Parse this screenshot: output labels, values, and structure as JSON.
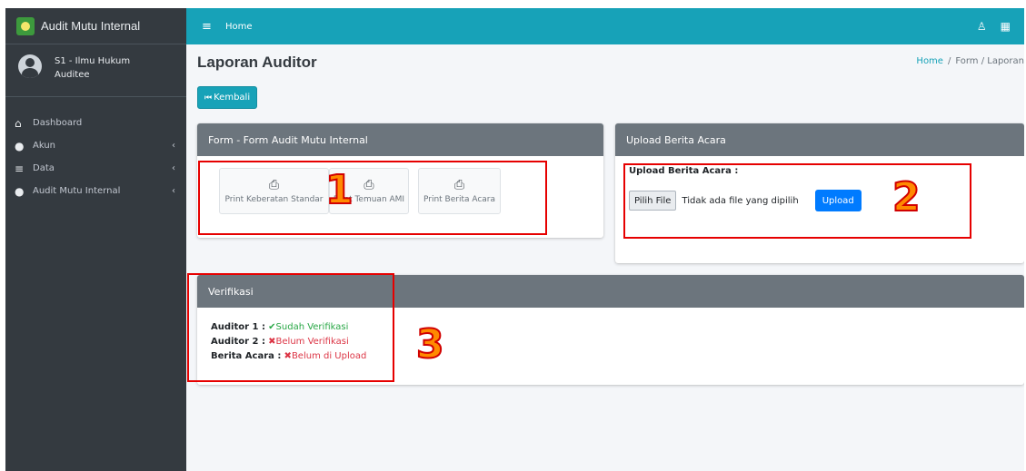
{
  "brand": {
    "title": "Audit Mutu Internal"
  },
  "user": {
    "name": "S1 - Ilmu Hukum",
    "role": "Auditee"
  },
  "sidebar": {
    "items": [
      {
        "label": "Dashboard",
        "icon": "home-icon",
        "caret": ""
      },
      {
        "label": "Akun",
        "icon": "user-icon",
        "caret": "‹"
      },
      {
        "label": "Data",
        "icon": "database-icon",
        "caret": "‹"
      },
      {
        "label": "Audit Mutu Internal",
        "icon": "users-icon",
        "caret": "‹"
      }
    ]
  },
  "topbar": {
    "home_label": "Home"
  },
  "page": {
    "title": "Laporan Auditor"
  },
  "breadcrumb": {
    "home": "Home",
    "sep": "/",
    "current": "Form / Laporan"
  },
  "back_button": {
    "label": "Kembali"
  },
  "form_card": {
    "title": "Form - Form Audit Mutu Internal",
    "buttons": [
      "Print Keberatan Standar",
      "Print Temuan AMI",
      "Print Berita Acara"
    ]
  },
  "upload_card": {
    "title": "Upload Berita Acara",
    "label": "Upload Berita Acara :",
    "file_button": "Pilih File",
    "file_status": "Tidak ada file yang dipilih",
    "upload_button": "Upload"
  },
  "verif_card": {
    "title": "Verifikasi",
    "rows": [
      {
        "label": "Auditor 1 :",
        "status": "Sudah Verifikasi",
        "state": "ok"
      },
      {
        "label": "Auditor 2 :",
        "status": "Belum Verifikasi",
        "state": "bad"
      },
      {
        "label": "Berita Acara :",
        "status": "Belum di Upload",
        "state": "bad"
      }
    ]
  },
  "annotations": [
    "1",
    "2",
    "3"
  ],
  "colors": {
    "accent": "#17a2b8",
    "sidebar": "#343a40",
    "card_header": "#6c757d",
    "primary": "#007bff",
    "success": "#28a745",
    "danger": "#dc3545",
    "annotation_box": "#e60000"
  }
}
